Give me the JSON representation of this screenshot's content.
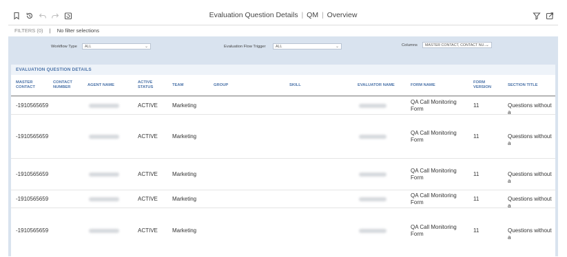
{
  "header": {
    "title_main": "Evaluation Question Details",
    "title_sep": "|",
    "title_qm": "QM",
    "title_overview": "Overview",
    "icons": [
      "bookmark-icon",
      "history-icon",
      "undo-icon",
      "redo-icon",
      "refresh-icon",
      "filter-icon",
      "export-icon"
    ]
  },
  "filters": {
    "label": "FILTERS (0)",
    "divider": "|",
    "status": "No filter selections"
  },
  "controls": {
    "workflow_type_label": "Workflow Type",
    "workflow_type_value": "ALL",
    "flow_trigger_label": "Evaluation Flow Trigger",
    "flow_trigger_value": "ALL",
    "columns_label": "Columns",
    "columns_value": "MASTER CONTACT, CONTACT NU..."
  },
  "table": {
    "section_title": "EVALUATION QUESTION DETAILS",
    "columns": [
      {
        "key": "master_contact",
        "lines": [
          "MASTER",
          "CONTACT"
        ]
      },
      {
        "key": "contact_number",
        "lines": [
          "CONTACT",
          "NUMBER"
        ]
      },
      {
        "key": "agent_name",
        "lines": [
          "AGENT NAME"
        ]
      },
      {
        "key": "active_status",
        "lines": [
          "ACTIVE",
          "STATUS"
        ]
      },
      {
        "key": "team",
        "lines": [
          "TEAM"
        ]
      },
      {
        "key": "group",
        "lines": [
          "GROUP"
        ]
      },
      {
        "key": "skill",
        "lines": [
          "SKILL"
        ]
      },
      {
        "key": "evaluator_name",
        "lines": [
          "EVALUATOR NAME"
        ]
      },
      {
        "key": "form_name",
        "lines": [
          "FORM NAME"
        ]
      },
      {
        "key": "form_version",
        "lines": [
          "FORM",
          "VERSION"
        ]
      },
      {
        "key": "section_title",
        "lines": [
          "SECTION TITLE"
        ]
      }
    ],
    "rows": [
      {
        "master_contact": "-1910565659",
        "active_status": "ACTIVE",
        "team": "Marketing",
        "form_name": [
          "QA Call Monitoring",
          "Form"
        ],
        "form_version": "11",
        "section_title": "Questions without a"
      },
      {
        "master_contact": "-1910565659",
        "active_status": "ACTIVE",
        "team": "Marketing",
        "form_name": [
          "QA Call Monitoring",
          "Form"
        ],
        "form_version": "11",
        "section_title": "Questions without a"
      },
      {
        "master_contact": "-1910565659",
        "active_status": "ACTIVE",
        "team": "Marketing",
        "form_name": [
          "QA Call Monitoring",
          "Form"
        ],
        "form_version": "11",
        "section_title": "Questions without a"
      },
      {
        "master_contact": "-1910565659",
        "active_status": "ACTIVE",
        "team": "Marketing",
        "form_name": [
          "QA Call Monitoring",
          "Form"
        ],
        "form_version": "11",
        "section_title": "Questions without a"
      },
      {
        "master_contact": "-1910565659",
        "active_status": "ACTIVE",
        "team": "Marketing",
        "form_name": [
          "QA Call Monitoring",
          "Form"
        ],
        "form_version": "11",
        "section_title": "Questions without a"
      }
    ]
  }
}
